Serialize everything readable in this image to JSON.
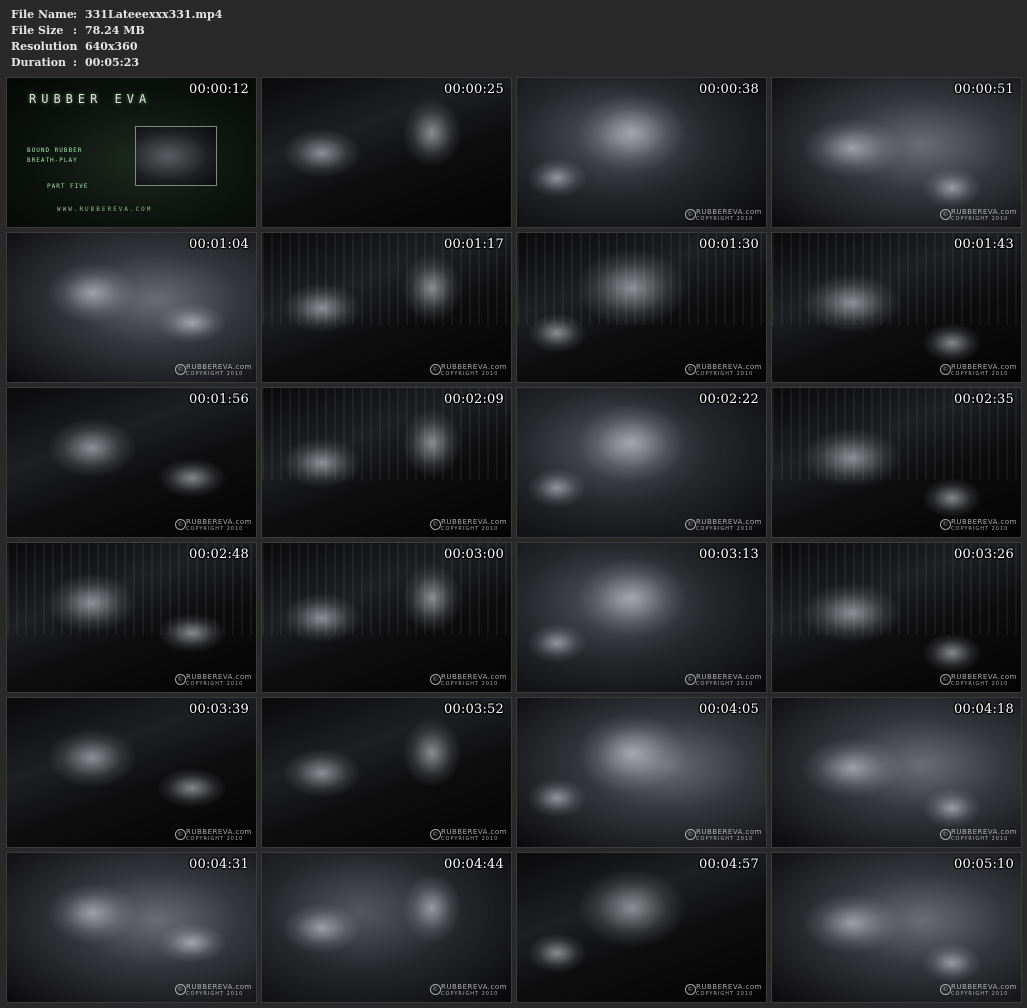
{
  "info": {
    "file_name_label": "File Name",
    "file_name": "331Lateeexxx331.mp4",
    "file_size_label": "File Size",
    "file_size": "78.24 MB",
    "resolution_label": "Resolution",
    "resolution": "640x360",
    "duration_label": "Duration",
    "duration": "00:05:23",
    "colon": ":"
  },
  "title_card": {
    "logo": "RUBBER EVA",
    "subtitle_line1": "BOUND RUBBER",
    "subtitle_line2": "BREATH-PLAY",
    "part": "PART FIVE",
    "url": "WWW.RUBBEREVA.COM"
  },
  "watermark": {
    "icon": "copyright-icon",
    "brand": "RUBBEREVA.com",
    "copyright": "COPYRIGHT 2010"
  },
  "thumbnails": [
    {
      "time": "00:00:12",
      "style": "t0",
      "watermark": false
    },
    {
      "time": "00:00:25",
      "style": "t2",
      "watermark": false
    },
    {
      "time": "00:00:38",
      "style": "t1",
      "watermark": true
    },
    {
      "time": "00:00:51",
      "style": "t3",
      "watermark": true
    },
    {
      "time": "00:01:04",
      "style": "t3",
      "watermark": true
    },
    {
      "time": "00:01:17",
      "style": "t2",
      "watermark": true,
      "curtain": true
    },
    {
      "time": "00:01:30",
      "style": "t2",
      "watermark": true,
      "curtain": true
    },
    {
      "time": "00:01:43",
      "style": "t2",
      "watermark": true,
      "curtain": true
    },
    {
      "time": "00:01:56",
      "style": "t2",
      "watermark": true
    },
    {
      "time": "00:02:09",
      "style": "t2",
      "watermark": true,
      "curtain": true
    },
    {
      "time": "00:02:22",
      "style": "t1",
      "watermark": true
    },
    {
      "time": "00:02:35",
      "style": "t2",
      "watermark": true,
      "curtain": true
    },
    {
      "time": "00:02:48",
      "style": "t2",
      "watermark": true,
      "curtain": true
    },
    {
      "time": "00:03:00",
      "style": "t2",
      "watermark": true,
      "curtain": true
    },
    {
      "time": "00:03:13",
      "style": "t1",
      "watermark": true
    },
    {
      "time": "00:03:26",
      "style": "t2",
      "watermark": true,
      "curtain": true
    },
    {
      "time": "00:03:39",
      "style": "t2",
      "watermark": true
    },
    {
      "time": "00:03:52",
      "style": "t2",
      "watermark": true
    },
    {
      "time": "00:04:05",
      "style": "t3",
      "watermark": true
    },
    {
      "time": "00:04:18",
      "style": "t3",
      "watermark": true
    },
    {
      "time": "00:04:31",
      "style": "t3",
      "watermark": true
    },
    {
      "time": "00:04:44",
      "style": "t1",
      "watermark": true
    },
    {
      "time": "00:04:57",
      "style": "t2",
      "watermark": true
    },
    {
      "time": "00:05:10",
      "style": "t3",
      "watermark": true
    }
  ]
}
